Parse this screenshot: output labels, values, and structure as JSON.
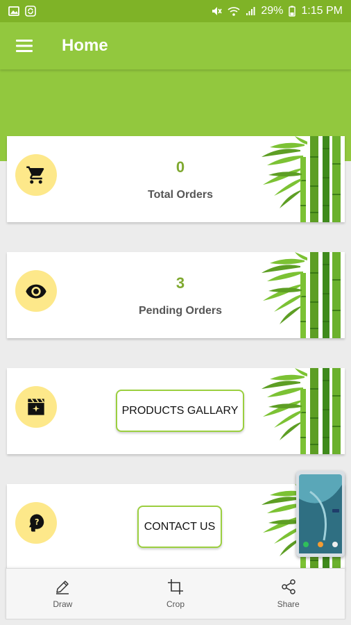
{
  "status": {
    "battery": "29%",
    "time": "1:15 PM"
  },
  "header": {
    "title": "Home"
  },
  "cards": [
    {
      "count": "0",
      "label": "Total Orders",
      "icon": "cart-icon"
    },
    {
      "count": "3",
      "label": "Pending Orders",
      "icon": "eye-icon"
    },
    {
      "button": "PRODUCTS GALLARY",
      "icon": "clapperboard-icon"
    },
    {
      "button": "CONTACT US",
      "icon": "head-question-icon"
    }
  ],
  "bottom": {
    "draw": "Draw",
    "crop": "Crop",
    "share": "Share"
  },
  "colors": {
    "primary": "#92c83e",
    "status": "#7fb327",
    "accent": "#7fa930",
    "iconbg": "#fde88a"
  }
}
